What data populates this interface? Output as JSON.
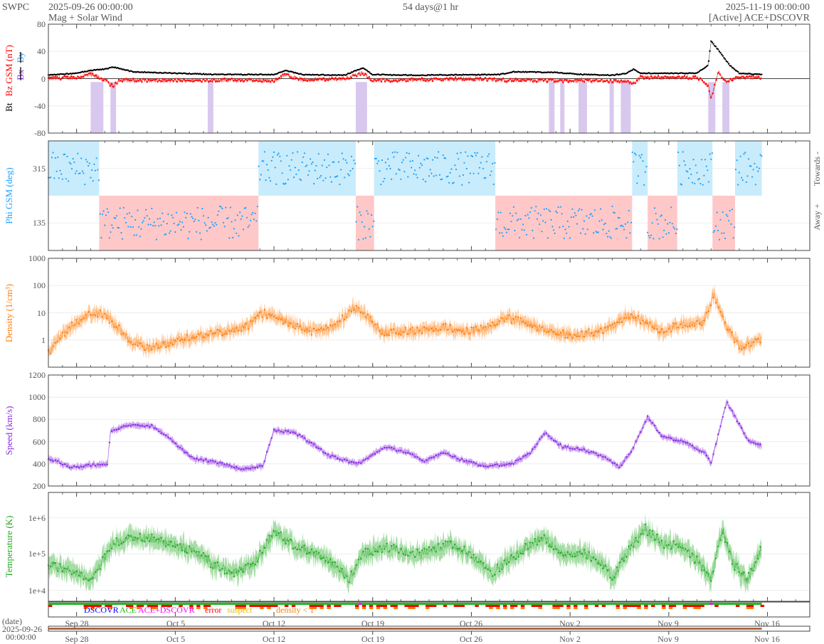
{
  "header": {
    "org": "SWPC",
    "start": "2025-09-26 00:00:00",
    "product": "Mag + Solar Wind",
    "span": "54 days@1 hr",
    "end": "2025-11-19 00:00:00",
    "source": "[Active] ACE+DSCOVR"
  },
  "colors": {
    "bt": "#000000",
    "bz": "#ff0000",
    "bx": "#8a2be2",
    "by": "#1ea0ff",
    "density": "#ff7f0e",
    "speed": "#8a2be2",
    "temp": "#22aa22",
    "towards": "#c8ecfb",
    "away": "#ffc8c8"
  },
  "chart_data": [
    {
      "type": "line",
      "title": "Mag",
      "ylabel_parts": {
        "bt": "Bt",
        "bz": "Bz GSM (nT)",
        "bx": "Bx",
        "by": "By"
      },
      "ylim": [
        -80,
        80
      ],
      "yticks": [
        "80",
        "40",
        "0",
        "-40",
        "-80"
      ],
      "series": [
        {
          "name": "Bt",
          "points": [
            [
              0,
              5
            ],
            [
              2,
              8
            ],
            [
              3,
              12
            ],
            [
              4,
              14
            ],
            [
              4.6,
              17
            ],
            [
              6,
              10
            ],
            [
              9,
              8
            ],
            [
              12,
              6
            ],
            [
              16,
              6
            ],
            [
              16.8,
              12
            ],
            [
              18,
              6
            ],
            [
              21,
              5
            ],
            [
              22.3,
              16
            ],
            [
              23,
              6
            ],
            [
              26,
              5
            ],
            [
              32,
              6
            ],
            [
              33,
              10
            ],
            [
              36,
              9
            ],
            [
              38,
              6
            ],
            [
              40,
              5
            ],
            [
              41,
              8
            ],
            [
              41.5,
              14
            ],
            [
              42,
              8
            ],
            [
              46,
              8
            ],
            [
              46.8,
              20
            ],
            [
              47,
              55
            ],
            [
              47.6,
              40
            ],
            [
              48.3,
              20
            ],
            [
              49,
              8
            ],
            [
              50.6,
              6
            ]
          ]
        },
        {
          "name": "Bz",
          "points": [
            [
              0,
              0
            ],
            [
              2,
              2
            ],
            [
              3,
              6
            ],
            [
              4,
              -2
            ],
            [
              4.6,
              -12
            ],
            [
              5,
              -2
            ],
            [
              8,
              -3
            ],
            [
              12,
              -2
            ],
            [
              16,
              -3
            ],
            [
              16.8,
              6
            ],
            [
              18,
              -2
            ],
            [
              21,
              0
            ],
            [
              22.3,
              8
            ],
            [
              23,
              -3
            ],
            [
              30,
              0
            ],
            [
              32,
              -2
            ],
            [
              35,
              -3
            ],
            [
              38,
              -3
            ],
            [
              41,
              -4
            ],
            [
              41.5,
              -8
            ],
            [
              42,
              2
            ],
            [
              46,
              2
            ],
            [
              46.8,
              -10
            ],
            [
              47,
              -30
            ],
            [
              47.5,
              10
            ],
            [
              48,
              -5
            ],
            [
              49,
              2
            ],
            [
              50.6,
              2
            ]
          ]
        }
      ],
      "shaded_days": [
        [
          3,
          3.9
        ],
        [
          4.4,
          4.8
        ],
        [
          11.3,
          11.7
        ],
        [
          21.8,
          22.6
        ],
        [
          35.5,
          35.9
        ],
        [
          36.3,
          36.6
        ],
        [
          37.6,
          38.2
        ],
        [
          39.8,
          40.1
        ],
        [
          40.6,
          41.3
        ],
        [
          46.8,
          47.3
        ],
        [
          47.8,
          48.3
        ]
      ]
    },
    {
      "type": "scatter",
      "title": "Phi",
      "ylabel": "Phi GSM (deg)",
      "ylim": [
        45,
        405
      ],
      "yticks": [
        "315",
        "135"
      ],
      "right_labels": {
        "towards": "Towards -",
        "away": "Away +"
      },
      "sectors": [
        {
          "from": 0,
          "to": 3.6,
          "side": "towards"
        },
        {
          "from": 3.6,
          "to": 14.9,
          "side": "away"
        },
        {
          "from": 14.9,
          "to": 21.8,
          "side": "towards"
        },
        {
          "from": 21.8,
          "to": 23.1,
          "side": "away"
        },
        {
          "from": 23.1,
          "to": 31.7,
          "side": "towards"
        },
        {
          "from": 31.7,
          "to": 41.4,
          "side": "away"
        },
        {
          "from": 41.4,
          "to": 42.5,
          "side": "towards"
        },
        {
          "from": 42.5,
          "to": 44.6,
          "side": "away"
        },
        {
          "from": 44.6,
          "to": 47.1,
          "side": "towards"
        },
        {
          "from": 47.1,
          "to": 48.7,
          "side": "away"
        },
        {
          "from": 48.7,
          "to": 50.6,
          "side": "towards"
        }
      ]
    },
    {
      "type": "line",
      "title": "Density",
      "ylabel": "Density (1/cm³)",
      "yscale": "log",
      "ylim": [
        0.1,
        1000
      ],
      "yticks": [
        "1000",
        "100",
        "10",
        "1"
      ],
      "points": [
        [
          0,
          0.3
        ],
        [
          0.6,
          1
        ],
        [
          1.6,
          3
        ],
        [
          3.1,
          10
        ],
        [
          4.1,
          8
        ],
        [
          5.7,
          1
        ],
        [
          7.1,
          0.5
        ],
        [
          9.2,
          1
        ],
        [
          11.2,
          1.5
        ],
        [
          12.7,
          2
        ],
        [
          14,
          3
        ],
        [
          15.2,
          10
        ],
        [
          16.8,
          5
        ],
        [
          18.8,
          2
        ],
        [
          20.3,
          3
        ],
        [
          21.6,
          15
        ],
        [
          22.3,
          10
        ],
        [
          23.6,
          2
        ],
        [
          25.9,
          2
        ],
        [
          27.9,
          3
        ],
        [
          29.9,
          2
        ],
        [
          31.4,
          3
        ],
        [
          32.4,
          7
        ],
        [
          33.9,
          4
        ],
        [
          35.5,
          2
        ],
        [
          37,
          1.5
        ],
        [
          39,
          2
        ],
        [
          40,
          3
        ],
        [
          41,
          8
        ],
        [
          42.5,
          4
        ],
        [
          43.5,
          2
        ],
        [
          45,
          4
        ],
        [
          46.5,
          5
        ],
        [
          47.2,
          50
        ],
        [
          48.1,
          3
        ],
        [
          49.1,
          0.5
        ],
        [
          50.6,
          1.2
        ]
      ]
    },
    {
      "type": "line",
      "title": "Speed",
      "ylabel": "Speed (km/s)",
      "ylim": [
        200,
        1200
      ],
      "yticks": [
        "1200",
        "1000",
        "800",
        "600",
        "400",
        "200"
      ],
      "points": [
        [
          0,
          450
        ],
        [
          1.6,
          370
        ],
        [
          4.2,
          400
        ],
        [
          4.4,
          700
        ],
        [
          5.7,
          750
        ],
        [
          7.4,
          740
        ],
        [
          8.7,
          620
        ],
        [
          10.2,
          450
        ],
        [
          11.7,
          420
        ],
        [
          13.7,
          350
        ],
        [
          15.2,
          380
        ],
        [
          16,
          700
        ],
        [
          17.5,
          680
        ],
        [
          18.5,
          600
        ],
        [
          19.8,
          480
        ],
        [
          21.3,
          420
        ],
        [
          22,
          400
        ],
        [
          23.8,
          550
        ],
        [
          25.6,
          500
        ],
        [
          26.6,
          420
        ],
        [
          28.1,
          500
        ],
        [
          29.4,
          430
        ],
        [
          30.9,
          380
        ],
        [
          32.9,
          400
        ],
        [
          34.2,
          500
        ],
        [
          35.2,
          680
        ],
        [
          36.5,
          550
        ],
        [
          38,
          530
        ],
        [
          39.5,
          450
        ],
        [
          40.5,
          370
        ],
        [
          41.3,
          500
        ],
        [
          42.5,
          820
        ],
        [
          43.5,
          650
        ],
        [
          45,
          600
        ],
        [
          46.6,
          500
        ],
        [
          47,
          400
        ],
        [
          48.1,
          960
        ],
        [
          48.8,
          800
        ],
        [
          49.6,
          620
        ],
        [
          50.6,
          560
        ]
      ]
    },
    {
      "type": "line",
      "title": "Temperature",
      "ylabel": "Temperature (K)",
      "yscale": "log",
      "ylim": [
        5000,
        5000000
      ],
      "yticks": [
        "1e+6",
        "1e+5",
        "1e+4"
      ],
      "points": [
        [
          0,
          50000
        ],
        [
          2.1,
          30000
        ],
        [
          3.1,
          20000
        ],
        [
          4.6,
          200000
        ],
        [
          6.6,
          300000
        ],
        [
          8.7,
          200000
        ],
        [
          10.7,
          100000
        ],
        [
          11.7,
          50000
        ],
        [
          13.2,
          30000
        ],
        [
          14.7,
          60000
        ],
        [
          16,
          400000
        ],
        [
          17.2,
          200000
        ],
        [
          18.8,
          100000
        ],
        [
          20.3,
          50000
        ],
        [
          21.3,
          20000
        ],
        [
          22.3,
          100000
        ],
        [
          23.8,
          150000
        ],
        [
          26.4,
          100000
        ],
        [
          28.4,
          200000
        ],
        [
          29.9,
          100000
        ],
        [
          31.4,
          30000
        ],
        [
          32.9,
          80000
        ],
        [
          35,
          300000
        ],
        [
          36.5,
          100000
        ],
        [
          38,
          100000
        ],
        [
          39.5,
          50000
        ],
        [
          40,
          20000
        ],
        [
          41,
          100000
        ],
        [
          42.3,
          500000
        ],
        [
          43.5,
          200000
        ],
        [
          45,
          150000
        ],
        [
          46.3,
          50000
        ],
        [
          47,
          20000
        ],
        [
          47.8,
          500000
        ],
        [
          48.6,
          50000
        ],
        [
          49.6,
          20000
        ],
        [
          50.6,
          150000
        ]
      ]
    }
  ],
  "source_legend": [
    {
      "label": "DSCOVR",
      "color": "#0000ff"
    },
    {
      "label": "ACE",
      "color": "#22bb22"
    },
    {
      "label": "ACE+DSCOVR",
      "color": "#ff00ff"
    },
    {
      "label": "error",
      "color": "#ff0000"
    },
    {
      "label": "suspect",
      "color": "#e6c000"
    },
    {
      "label": "density < 1",
      "color": "#ff7f0e"
    }
  ],
  "date_axis": {
    "label": "(date)",
    "start_date": "2025-09-26",
    "start_time": "00:00:00",
    "ticks": [
      [
        "Sep 28",
        2
      ],
      [
        "Oct 5",
        9
      ],
      [
        "Oct 12",
        16
      ],
      [
        "Oct 19",
        23
      ],
      [
        "Oct 26",
        30
      ],
      [
        "Nov 2",
        37
      ],
      [
        "Nov 9",
        44
      ],
      [
        "Nov 16",
        51
      ]
    ]
  }
}
